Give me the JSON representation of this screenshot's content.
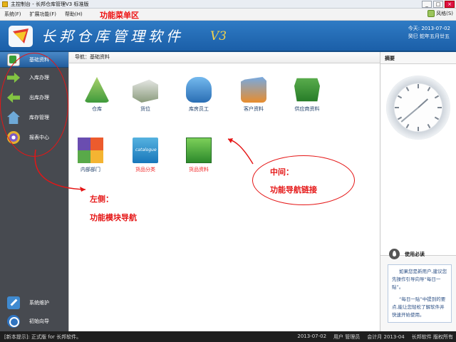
{
  "window": {
    "title": "主控制台 - 长邦仓库管理V3 标准版",
    "controls": [
      "_",
      "□",
      "×"
    ]
  },
  "menubar": {
    "items": [
      "系统(F)",
      "扩展功能(F)",
      "帮助(H)"
    ],
    "annotation": "功能菜单区",
    "style_label": "风格(S)"
  },
  "banner": {
    "app_name": "长邦仓库管理软件",
    "version": "V3",
    "today_label": "今天: 2013-07-02",
    "lunar_label": "癸巳 蛇年五月廿五"
  },
  "left_nav": {
    "items": [
      {
        "label": "基础资料",
        "icon": "database-icon",
        "active": true
      },
      {
        "label": "入库办理",
        "icon": "arrow-right-icon",
        "active": false
      },
      {
        "label": "出库办理",
        "icon": "arrow-left-icon",
        "active": false
      },
      {
        "label": "库存管理",
        "icon": "house-icon",
        "active": false
      },
      {
        "label": "报表中心",
        "icon": "report-icon",
        "active": false
      }
    ],
    "bottom_items": [
      {
        "label": "系统维护",
        "icon": "wrench-icon"
      },
      {
        "label": "初始向导",
        "icon": "guide-icon"
      }
    ]
  },
  "main": {
    "breadcrumb": "导航：基础资料",
    "tiles": [
      {
        "label": "仓库",
        "icon": "warehouse-icon",
        "highlight": false
      },
      {
        "label": "货位",
        "icon": "location-icon",
        "highlight": false
      },
      {
        "label": "库房员工",
        "icon": "staff-icon",
        "highlight": false
      },
      {
        "label": "客户资料",
        "icon": "customer-icon",
        "highlight": false
      },
      {
        "label": "供应商资料",
        "icon": "supplier-icon",
        "highlight": false
      },
      {
        "label": "内部部门",
        "icon": "department-icon",
        "highlight": false
      },
      {
        "label": "货品分类",
        "icon": "catalogue-icon",
        "highlight": true,
        "caption": "catalogue"
      },
      {
        "label": "货品资料",
        "icon": "goods-icon",
        "highlight": true
      }
    ]
  },
  "right_panel": {
    "summary_title": "摘要",
    "notice_title": "使用必读",
    "notice_paragraphs": [
      "如果您是新用户,建议您先操作引导向导“每日一贴”。",
      "“每日一贴”中提到的要点,能让您轻松了解软件并快速开始使用。"
    ]
  },
  "statusbar": {
    "left_text": "[新本提示]: 正式版 for 长邦软件。",
    "items": [
      "2013-07-02",
      "用户 管理员",
      "会计月 2013-04",
      "长邦软件 版权所有"
    ]
  },
  "annotations": {
    "left_title": "左侧：",
    "left_desc": "功能模块导航",
    "center_title": "中间：",
    "center_desc": "功能导航链接"
  }
}
